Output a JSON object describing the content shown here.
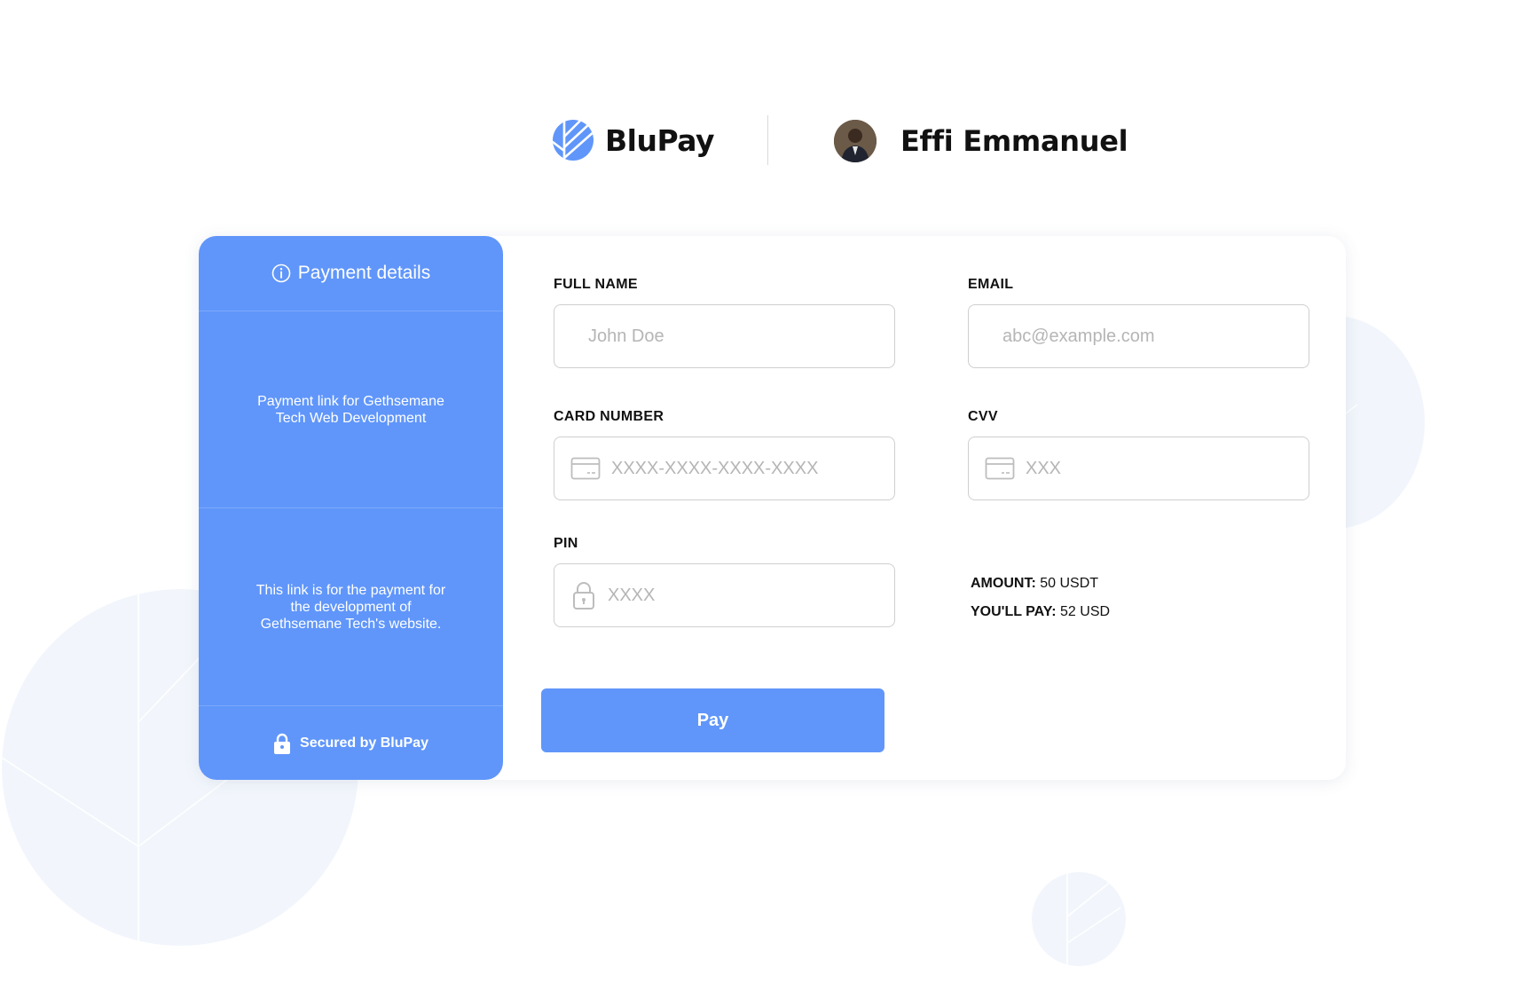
{
  "brand": {
    "name": "BluPay"
  },
  "merchant": {
    "name": "Effi Emmanuel"
  },
  "side_panel": {
    "header": "Payment details",
    "link_description": "Payment link for Gethsemane Tech Web Development",
    "payment_description": "This link is for the payment for the development of Gethsemane Tech's website.",
    "security_note": "Secured by BluPay"
  },
  "form": {
    "full_name": {
      "label": "FULL NAME",
      "placeholder": "John Doe",
      "value": ""
    },
    "email": {
      "label": "EMAIL",
      "placeholder": "abc@example.com",
      "value": ""
    },
    "card_number": {
      "label": "CARD NUMBER",
      "placeholder": "XXXX-XXXX-XXXX-XXXX",
      "value": ""
    },
    "cvv": {
      "label": "CVV",
      "placeholder": "XXX",
      "value": ""
    },
    "pin": {
      "label": "PIN",
      "placeholder": "XXXX",
      "value": ""
    }
  },
  "summary": {
    "amount_label": "AMOUNT:",
    "amount_value": "50 USDT",
    "pay_label": "YOU'LL PAY:",
    "pay_value": "52 USD"
  },
  "pay_button": {
    "label": "Pay"
  },
  "colors": {
    "accent": "#6096fa",
    "background_shape": "#f2f6fc",
    "placeholder": "#b5b5b5",
    "border": "#cfcfcf"
  },
  "icons": {
    "brand_logo": "blupay-logo-icon",
    "info": "info-icon",
    "lock": "lock-icon",
    "card": "credit-card-icon"
  }
}
